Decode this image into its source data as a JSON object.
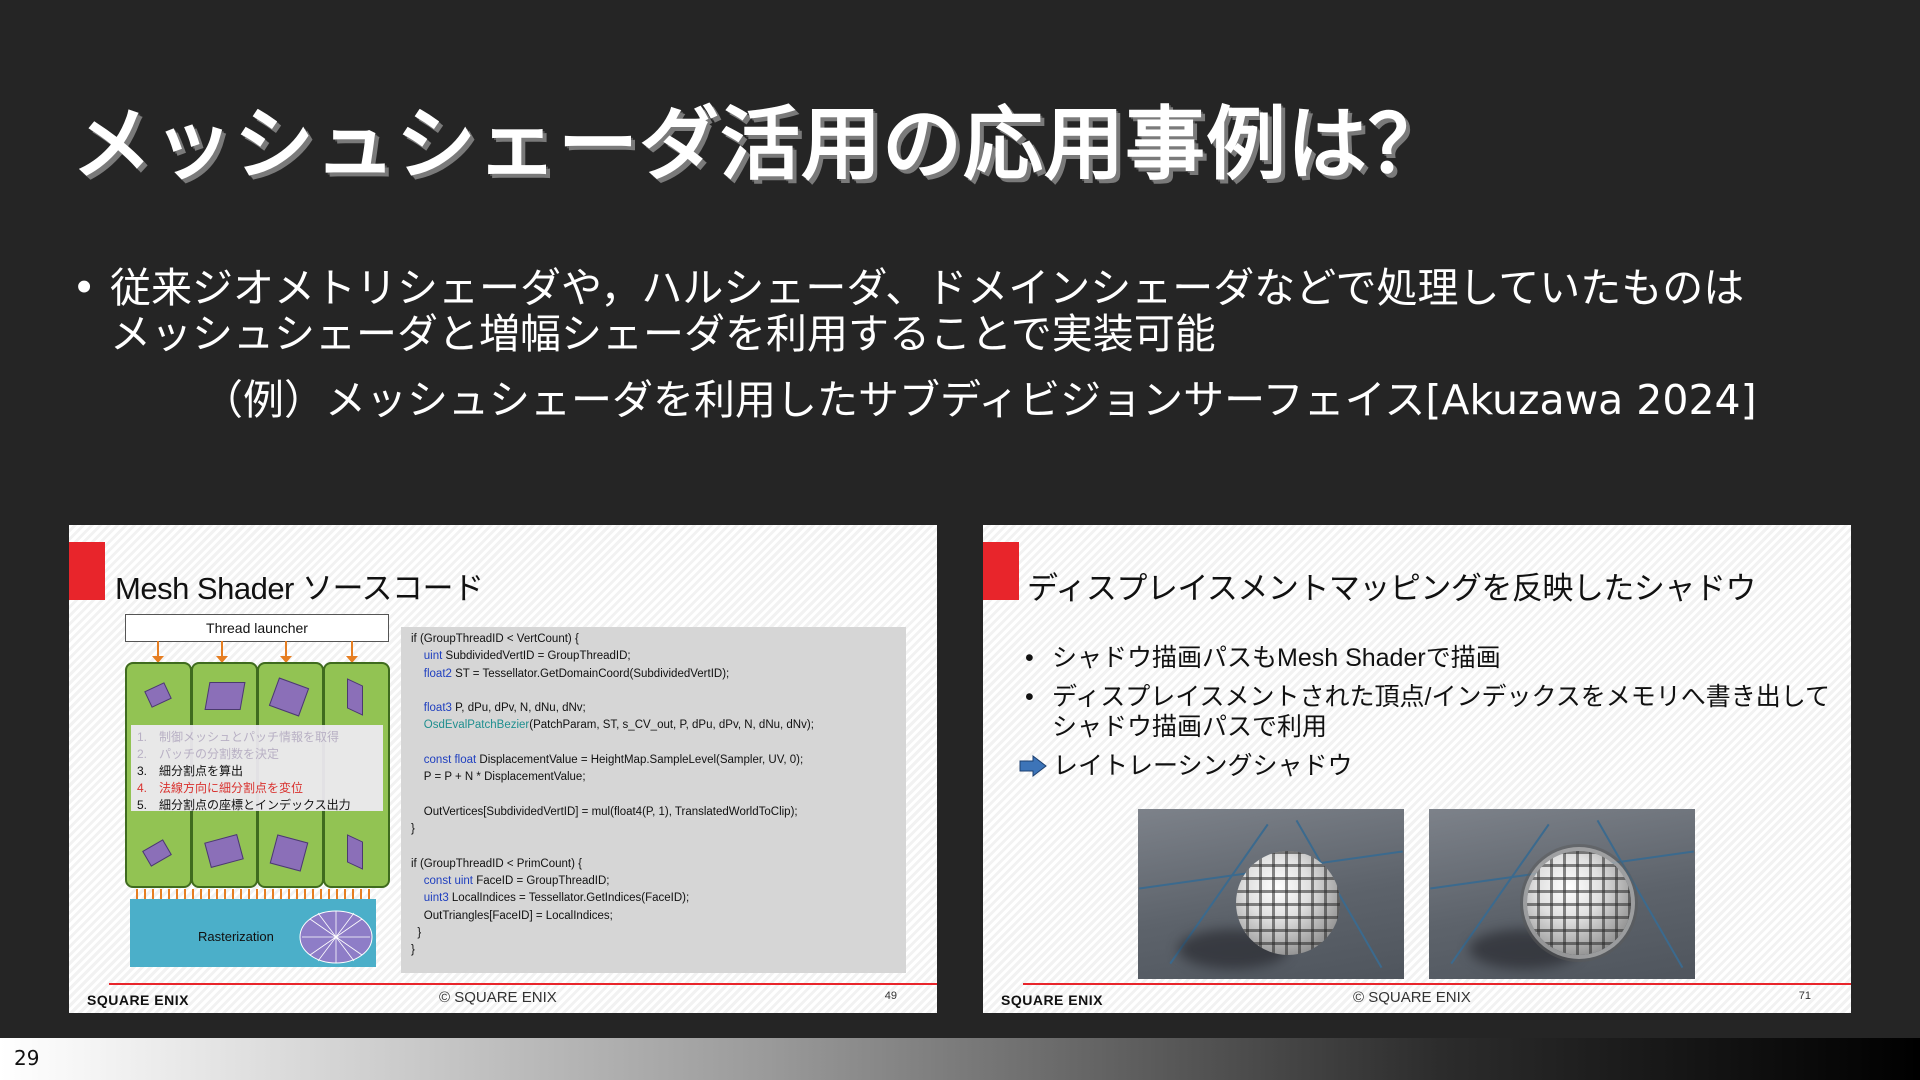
{
  "title": "メッシュシェーダ活用の応用事例は？",
  "bullet": {
    "line1": "従来ジオメトリシェーダや，ハルシェーダ、ドメインシェーダなどで処理していたものは",
    "line2": "メッシュシェーダと増幅シェーダを利用することで実装可能",
    "example": "（例）メッシュシェーダを利用したサブディビジョンサーフェイス[Akuzawa 2024]"
  },
  "left_slide": {
    "title": "Mesh Shader ソースコード",
    "launcher": "Thread launcher",
    "steps": [
      {
        "n": "1.",
        "text": "制御メッシュとパッチ情報を取得"
      },
      {
        "n": "2.",
        "text": "パッチの分割数を決定"
      },
      {
        "n": "3.",
        "text": "細分割点を算出"
      },
      {
        "n": "4.",
        "text": "法線方向に細分割点を変位"
      },
      {
        "n": "5.",
        "text": "細分割点の座標とインデックス出力"
      }
    ],
    "rasterization": "Rasterization",
    "code": {
      "l1": "if (GroupThreadID < VertCount) {",
      "l2a": "uint",
      "l2b": " SubdividedVertID = GroupThreadID;",
      "l3a": "float2",
      "l3b": " ST = Tessellator.GetDomainCoord(SubdividedVertID);",
      "l4a": "float3",
      "l4b": " P, dPu, dPv, N, dNu, dNv;",
      "l5a": "OsdEvalPatchBezier",
      "l5b": "(PatchParam, ST, s_CV_out, P, dPu, dPv, N, dNu, dNv);",
      "l6a": "const float",
      "l6b": " DisplacementValue = HeightMap.SampleLevel(Sampler, UV, 0);",
      "l7": "P = P + N * DisplacementValue;",
      "l8": "OutVertices[SubdividedVertID] = mul(float4(P, 1), TranslatedWorldToClip);",
      "l9": "}",
      "l10": "if (GroupThreadID < PrimCount) {",
      "l11a": "const uint",
      "l11b": " FaceID = GroupThreadID;",
      "l12a": "uint3",
      "l12b": " LocalIndices = Tessellator.GetIndices(FaceID);",
      "l13": "OutTriangles[FaceID] = LocalIndices;",
      "l14": "}",
      "l15": "}"
    },
    "brand": "SQUARE ENIX",
    "copyright": "© SQUARE ENIX",
    "page": "49"
  },
  "right_slide": {
    "title": "ディスプレイスメントマッピングを反映したシャドウ",
    "bullets": [
      "シャドウ描画パスもMesh Shaderで描画",
      "ディスプレイスメントされた頂点/インデックスをメモリへ書き出して",
      "シャドウ描画パスで利用"
    ],
    "arrow_text": "レイトレーシングシャドウ",
    "brand": "SQUARE ENIX",
    "copyright": "© SQUARE ENIX",
    "page": "71"
  },
  "page_number": "29",
  "colors": {
    "background": "#252525",
    "accent_red": "#e8252b",
    "arrow_blue": "#3d74b8"
  }
}
